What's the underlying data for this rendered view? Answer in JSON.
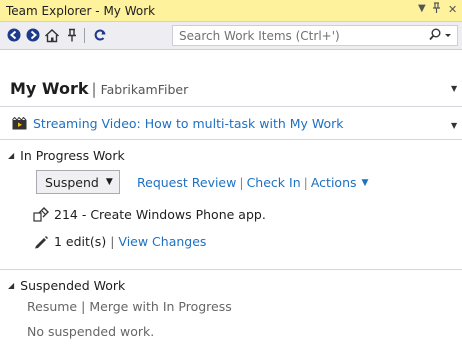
{
  "window": {
    "title": "Team Explorer - My Work",
    "dropdown_glyph": "▼",
    "pin_glyph": "ᵠ",
    "close_glyph": "✕"
  },
  "toolbar": {
    "search_placeholder": "Search Work Items (Ctrl+')"
  },
  "page": {
    "title": "My Work",
    "separator": "|",
    "project": "FabrikamFiber"
  },
  "video": {
    "label": "Streaming Video: How to multi-task with My Work"
  },
  "in_progress": {
    "header": "In Progress Work",
    "suspend_label": "Suspend",
    "request_review": "Request Review",
    "check_in": "Check In",
    "actions": "Actions",
    "work_item": "214 - Create Windows Phone app.",
    "edits": "1 edit(s)",
    "view_changes": "View Changes"
  },
  "suspended": {
    "header": "Suspended Work",
    "resume": "Resume",
    "merge": "Merge with In Progress",
    "empty": "No suspended work."
  },
  "colors": {
    "title_bar": "#fff29d",
    "link": "#1e70c2",
    "toolbar": "#eeeef2"
  }
}
